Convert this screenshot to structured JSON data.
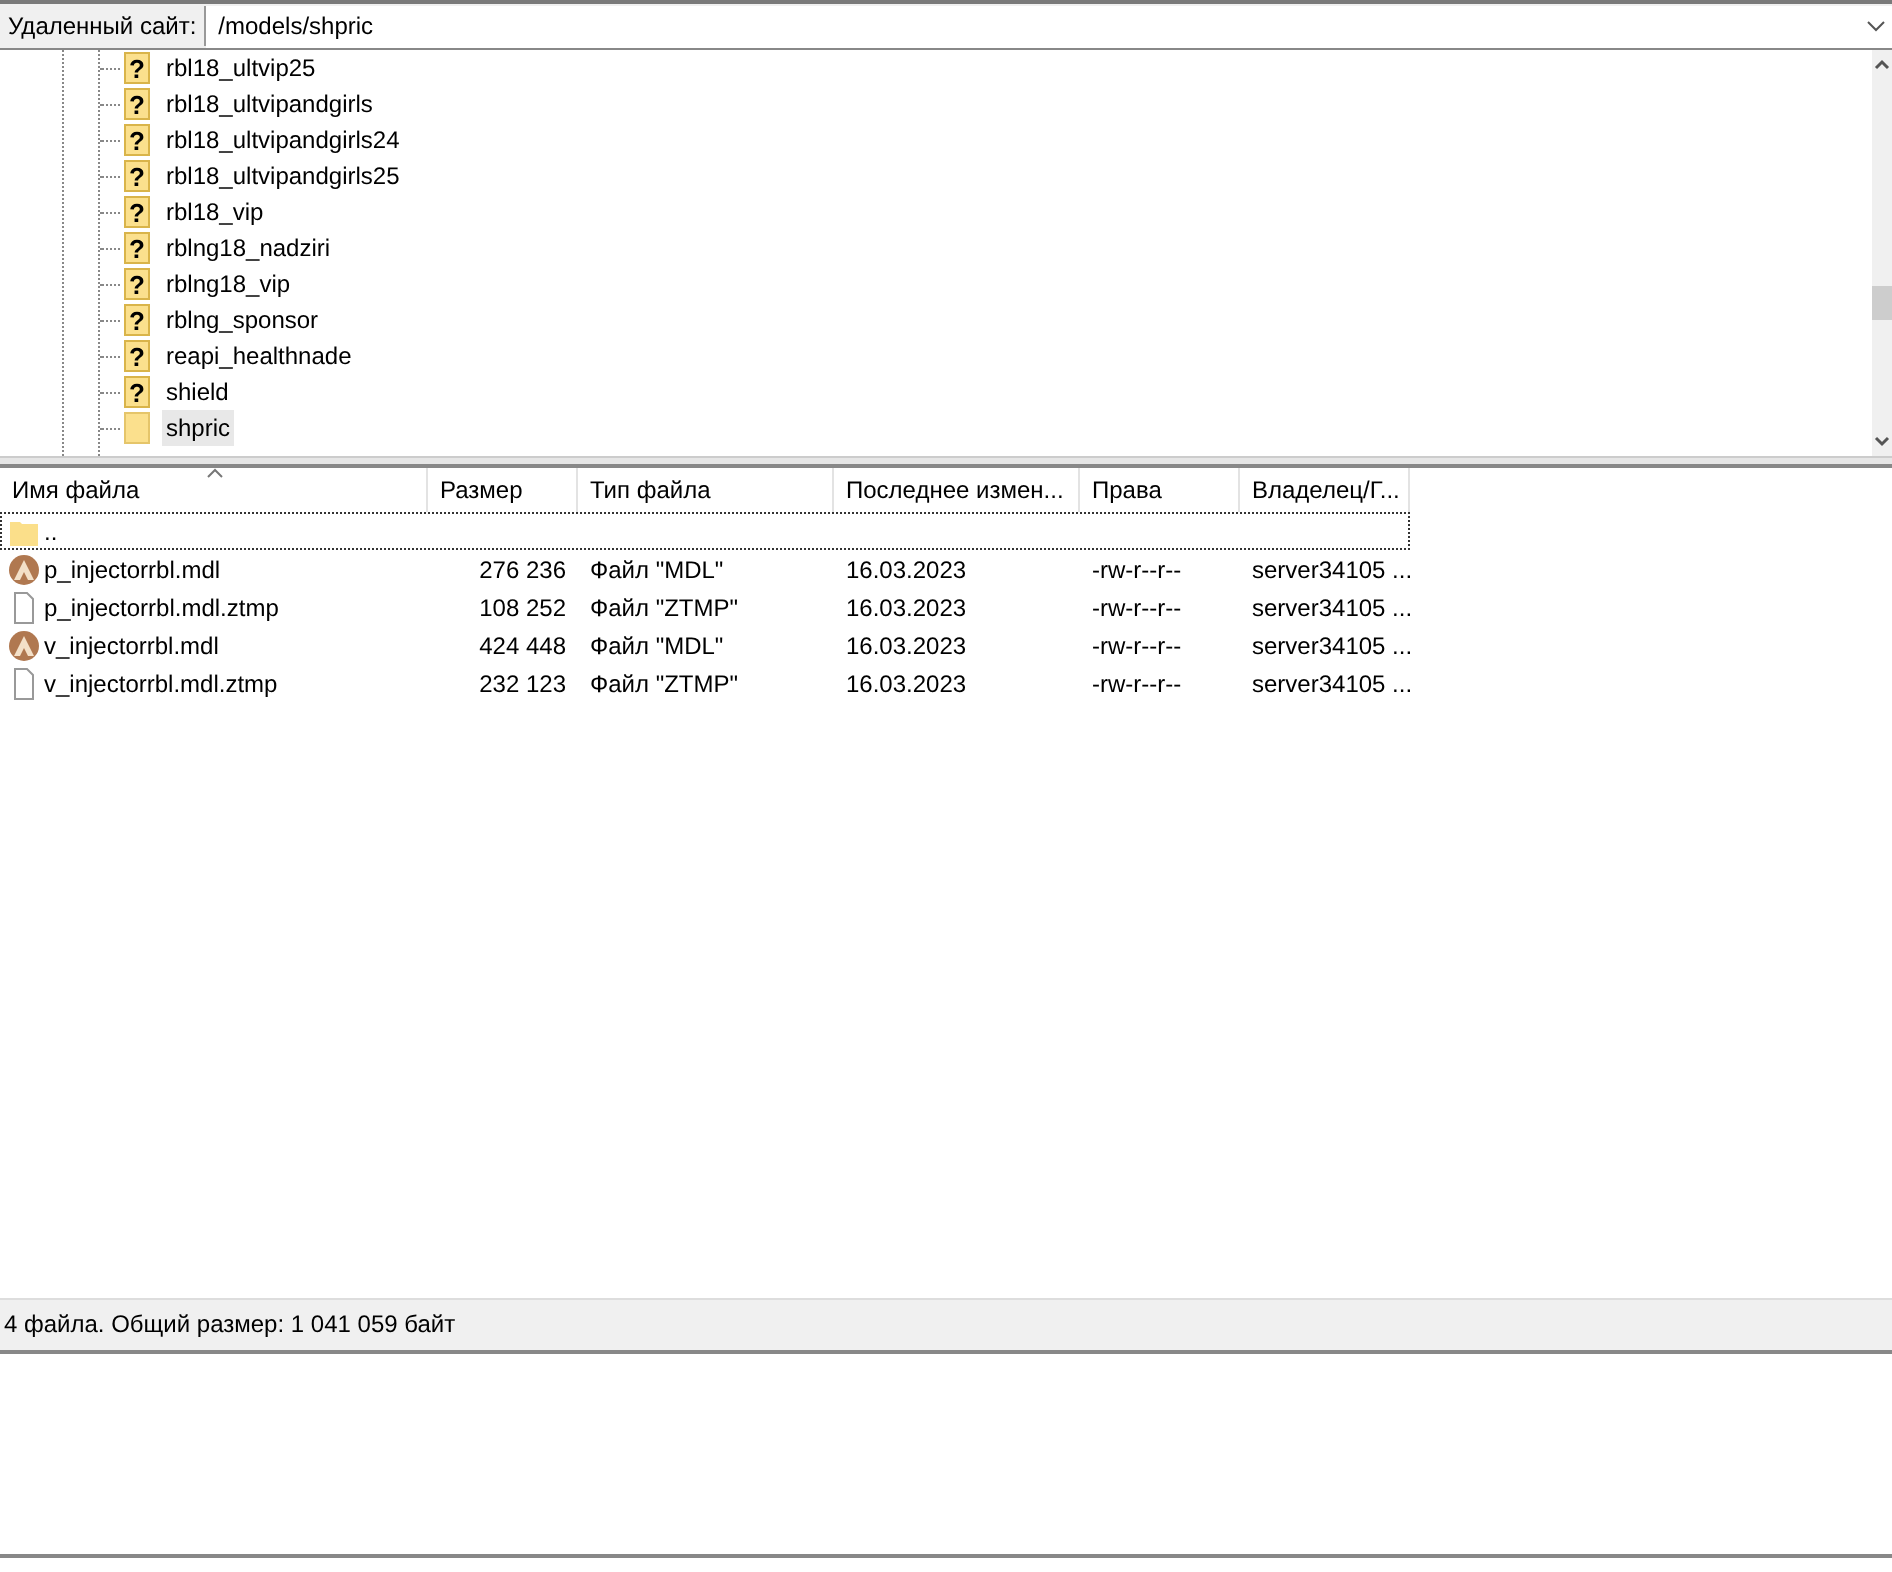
{
  "remote_site": {
    "label": "Удаленный сайт:",
    "path": "/models/shpric"
  },
  "tree": {
    "items": [
      {
        "name": "rbl18_ultvip25",
        "kind": "unknown",
        "icon": "?",
        "selected": false
      },
      {
        "name": "rbl18_ultvipandgirls",
        "kind": "unknown",
        "icon": "?",
        "selected": false
      },
      {
        "name": "rbl18_ultvipandgirls24",
        "kind": "unknown",
        "icon": "?",
        "selected": false
      },
      {
        "name": "rbl18_ultvipandgirls25",
        "kind": "unknown",
        "icon": "?",
        "selected": false
      },
      {
        "name": "rbl18_vip",
        "kind": "unknown",
        "icon": "?",
        "selected": false
      },
      {
        "name": "rblng18_nadziri",
        "kind": "unknown",
        "icon": "?",
        "selected": false
      },
      {
        "name": "rblng18_vip",
        "kind": "unknown",
        "icon": "?",
        "selected": false
      },
      {
        "name": "rblng_sponsor",
        "kind": "unknown",
        "icon": "?",
        "selected": false
      },
      {
        "name": "reapi_healthnade",
        "kind": "unknown",
        "icon": "?",
        "selected": false
      },
      {
        "name": "shield",
        "kind": "unknown",
        "icon": "?",
        "selected": false
      },
      {
        "name": "shpric",
        "kind": "folder",
        "selected": true
      }
    ]
  },
  "table": {
    "columns": [
      {
        "label": "Имя файла",
        "sorted": true
      },
      {
        "label": "Размер",
        "sorted": false
      },
      {
        "label": "Тип файла",
        "sorted": false
      },
      {
        "label": "Последнее измен...",
        "sorted": false
      },
      {
        "label": "Права",
        "sorted": false
      },
      {
        "label": "Владелец/Г...",
        "sorted": false
      }
    ],
    "rows": [
      {
        "kind": "folder",
        "focused": true,
        "name": ".."
      },
      {
        "kind": "model",
        "focused": false,
        "name": "p_injectorrbl.mdl",
        "size": "276 236",
        "type": "Файл \"MDL\"",
        "modified": "16.03.2023",
        "permissions": "-rw-r--r--",
        "owner": "server34105 ..."
      },
      {
        "kind": "file",
        "focused": false,
        "name": "p_injectorrbl.mdl.ztmp",
        "size": "108 252",
        "type": "Файл \"ZTMP\"",
        "modified": "16.03.2023",
        "permissions": "-rw-r--r--",
        "owner": "server34105 ..."
      },
      {
        "kind": "model",
        "focused": false,
        "name": "v_injectorrbl.mdl",
        "size": "424 448",
        "type": "Файл \"MDL\"",
        "modified": "16.03.2023",
        "permissions": "-rw-r--r--",
        "owner": "server34105 ..."
      },
      {
        "kind": "file",
        "focused": false,
        "name": "v_injectorrbl.mdl.ztmp",
        "size": "232 123",
        "type": "Файл \"ZTMP\"",
        "modified": "16.03.2023",
        "permissions": "-rw-r--r--",
        "owner": "server34105 ..."
      }
    ]
  },
  "status_bar": "4 файла. Общий размер: 1 041 059 байт"
}
